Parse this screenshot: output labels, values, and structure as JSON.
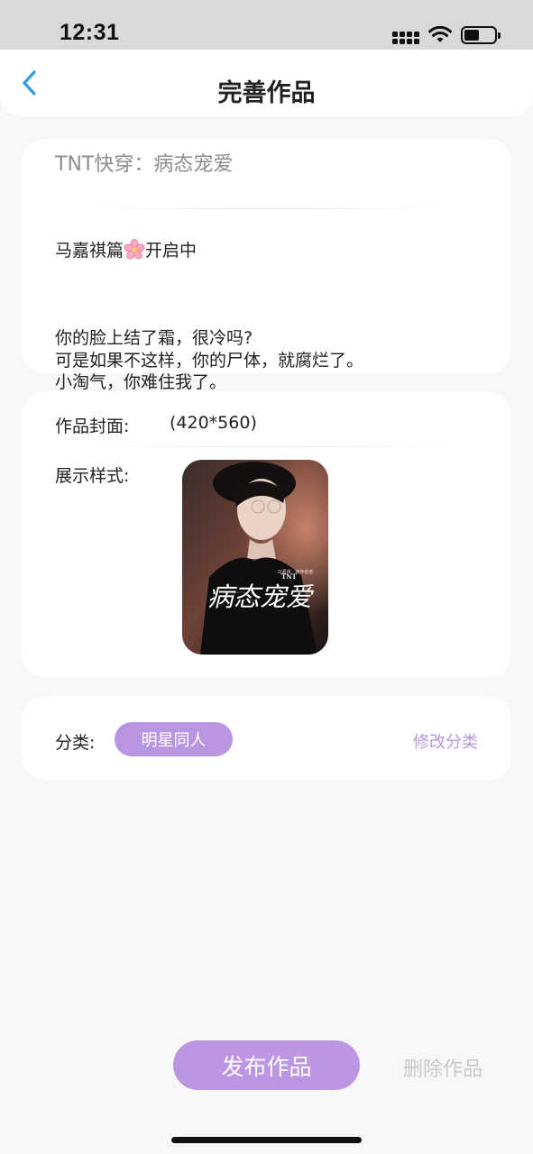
{
  "status_bar": {
    "time": "12:31"
  },
  "header": {
    "title": "完善作品",
    "back_icon": "chevron-left-icon"
  },
  "work": {
    "title": "TNT快穿：病态宠爱",
    "description_line1_prefix": "马嘉祺篇",
    "description_line1_suffix": "开启中",
    "description_body": "你的脸上结了霜，很冷吗?\n可是如果不这样，你的尸体，就腐烂了。\n小淘气，你难住我了。"
  },
  "cover": {
    "label": "作品封面:",
    "size": "(420*560)",
    "display_label": "展示样式:",
    "image_text_brand": "TNT",
    "image_text_title": "病态宠爱",
    "image_text_caption": "·马嘉祺 · 制作者者·"
  },
  "category": {
    "label": "分类:",
    "value": "明星同人",
    "edit_label": "修改分类",
    "accent": "#b995e2"
  },
  "actions": {
    "publish_label": "发布作品",
    "delete_label": "删除作品"
  }
}
